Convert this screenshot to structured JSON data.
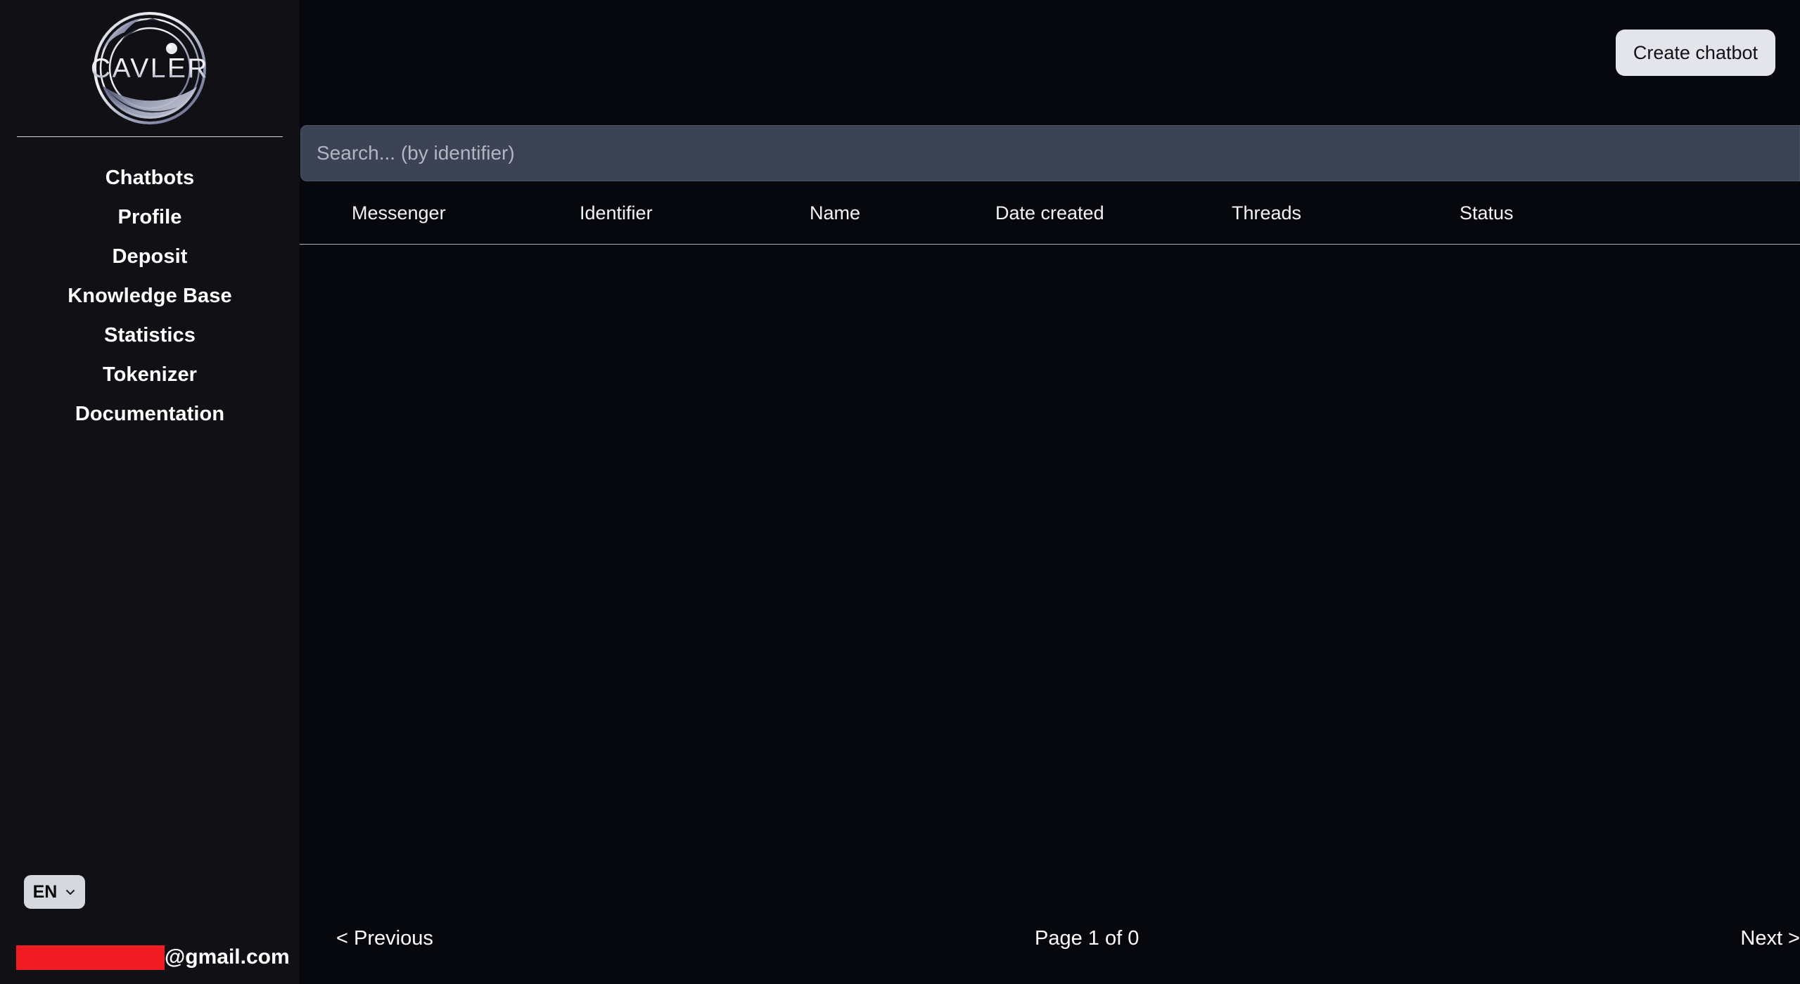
{
  "sidebar": {
    "logo": {
      "brand_text": "CAVLER",
      "icon": "cavler-circular-logo"
    },
    "nav_items": [
      {
        "label": "Chatbots",
        "name": "chatbots"
      },
      {
        "label": "Profile",
        "name": "profile"
      },
      {
        "label": "Deposit",
        "name": "deposit"
      },
      {
        "label": "Knowledge Base",
        "name": "knowledge-base"
      },
      {
        "label": "Statistics",
        "name": "statistics"
      },
      {
        "label": "Tokenizer",
        "name": "tokenizer"
      },
      {
        "label": "Documentation",
        "name": "documentation"
      }
    ],
    "language": {
      "selected": "EN",
      "chevron_icon": "chevron-down-icon"
    },
    "user": {
      "email_domain": "@gmail.com",
      "email_redacted": true
    }
  },
  "header": {
    "create_chatbot_label": "Create chatbot"
  },
  "search": {
    "placeholder": "Search... (by identifier)",
    "value": ""
  },
  "table": {
    "columns": [
      {
        "label": "Messenger",
        "name": "messenger"
      },
      {
        "label": "Identifier",
        "name": "identifier"
      },
      {
        "label": "Name",
        "name": "name"
      },
      {
        "label": "Date created",
        "name": "date-created"
      },
      {
        "label": "Threads",
        "name": "threads"
      },
      {
        "label": "Status",
        "name": "status"
      }
    ],
    "rows": []
  },
  "pagination": {
    "previous_label": "< Previous",
    "page_info": "Page 1 of 0",
    "next_label": "Next >"
  },
  "colors": {
    "sidebar_bg": "#111115",
    "main_bg": "#07070e",
    "accent_button": "#e4e5ea",
    "search_bg": "#3b4354",
    "redaction": "#f01c24"
  }
}
